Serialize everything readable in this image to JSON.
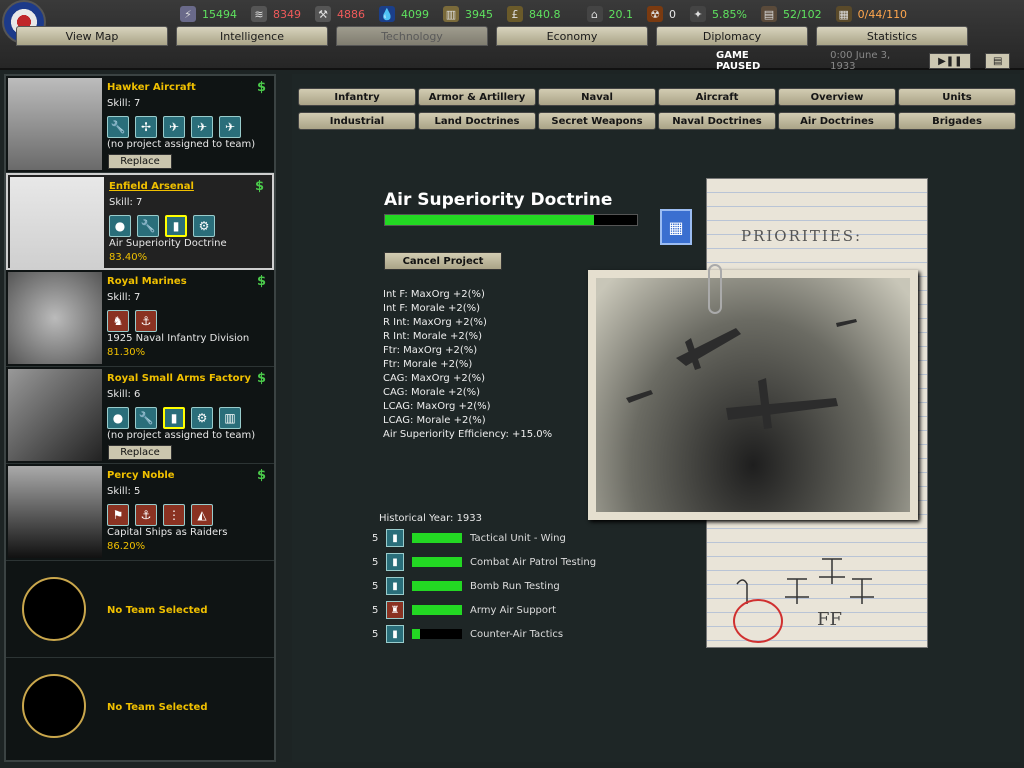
{
  "resources": {
    "manpower": "15494",
    "energy": "8349",
    "metal": "4886",
    "oil": "4099",
    "rare": "3945",
    "money": "840.8",
    "ic": "20.1",
    "nuke": "0",
    "dissent": "5.85%",
    "transport": "52/102",
    "convoys": "0/44/110"
  },
  "top_tabs": [
    "View Map",
    "Intelligence",
    "Technology",
    "Economy",
    "Diplomacy",
    "Statistics"
  ],
  "status": {
    "paused": "GAME PAUSED",
    "date": "0:00 June 3, 1933"
  },
  "subtabs_row1": [
    "Infantry",
    "Armor & Artillery",
    "Naval",
    "Aircraft",
    "Overview",
    "Units"
  ],
  "subtabs_row2": [
    "Industrial",
    "Land Doctrines",
    "Secret Weapons",
    "Naval Doctrines",
    "Air Doctrines",
    "Brigades"
  ],
  "teams": [
    {
      "name": "Hawker Aircraft",
      "skill": "Skill: 7",
      "project": "(no project assigned to team)",
      "replace": "Replace",
      "icons": [
        "wrench-icon",
        "propeller-icon",
        "fighter-icon",
        "bomber-icon",
        "plane-icon"
      ]
    },
    {
      "name": "Enfield Arsenal",
      "skill": "Skill: 7",
      "project": "Air Superiority Doctrine",
      "pct": "83.40%",
      "icons": [
        "grenade-icon",
        "wrench-icon",
        "book-icon",
        "gear-book-icon"
      ]
    },
    {
      "name": "Royal Marines",
      "skill": "Skill: 7",
      "project": "1925 Naval Infantry Division",
      "pct": "81.30%",
      "icons": [
        "troops-icon",
        "anchor-icon"
      ]
    },
    {
      "name": "Royal Small Arms Factory",
      "skill": "Skill: 6",
      "project": "(no project assigned to team)",
      "replace": "Replace",
      "icons": [
        "grenade-icon",
        "wrench-icon",
        "book-icon",
        "gear-book-icon",
        "factory-icon"
      ]
    },
    {
      "name": "Percy Noble",
      "skill": "Skill: 5",
      "project": "Capital Ships as Raiders",
      "pct": "86.20%",
      "icons": [
        "command-icon",
        "anchor-icon",
        "fleet-icon",
        "sextant-icon"
      ]
    }
  ],
  "no_team": "No Team Selected",
  "project": {
    "title": "Air Superiority Doctrine",
    "progress": 0.83,
    "cancel": "Cancel Project",
    "effects": [
      "Int F: MaxOrg +2(%)",
      "Int F: Morale +2(%)",
      "R Int: MaxOrg +2(%)",
      "R Int: Morale +2(%)",
      "Ftr: MaxOrg +2(%)",
      "Ftr: Morale +2(%)",
      "CAG: MaxOrg +2(%)",
      "CAG: Morale +2(%)",
      "LCAG: MaxOrg +2(%)",
      "LCAG: Morale +2(%)",
      "Air Superiority Efficiency: +15.0%"
    ],
    "historical_year": "Historical Year: 1933",
    "components": [
      {
        "num": "5",
        "name": "Tactical Unit - Wing",
        "progress": 1.0
      },
      {
        "num": "5",
        "name": "Combat Air Patrol Testing",
        "progress": 1.0
      },
      {
        "num": "5",
        "name": "Bomb Run Testing",
        "progress": 1.0
      },
      {
        "num": "5",
        "name": "Army Air Support",
        "progress": 1.0
      },
      {
        "num": "5",
        "name": "Counter-Air Tactics",
        "progress": 0.15
      }
    ]
  },
  "notepad": {
    "heading": "PRIORITIES:",
    "note": "FF"
  }
}
